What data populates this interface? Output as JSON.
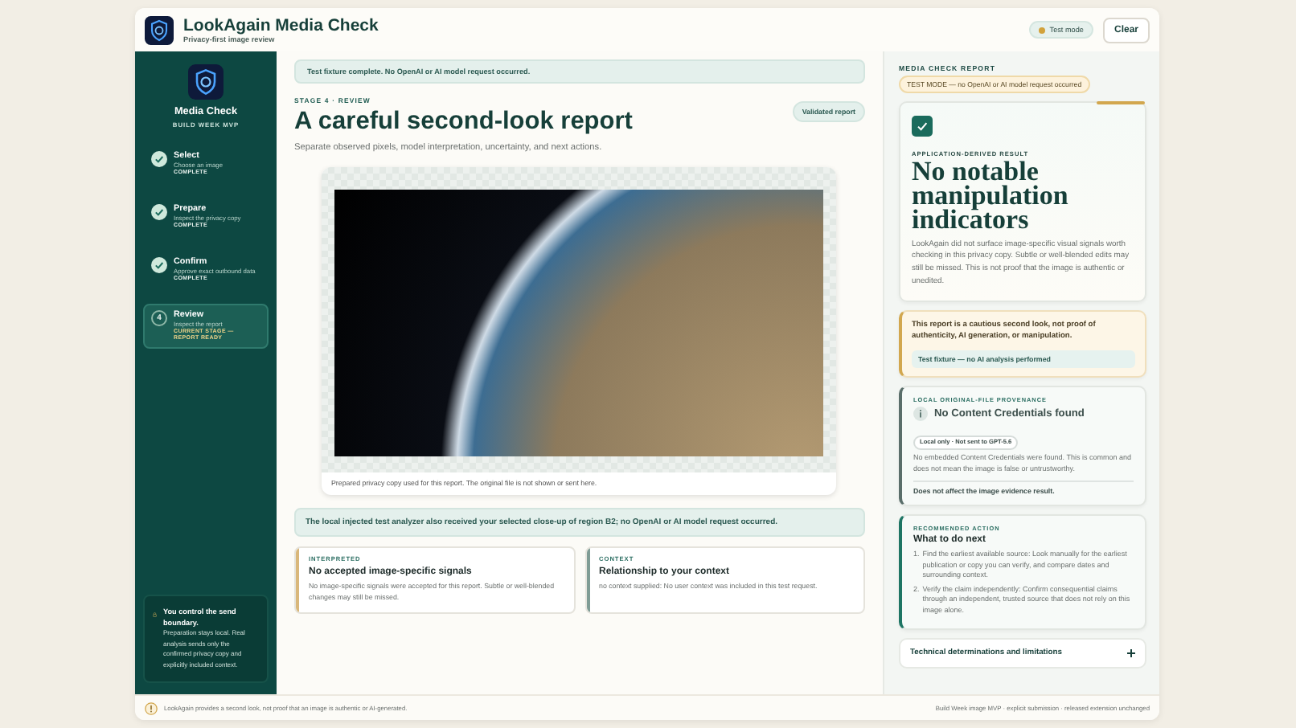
{
  "header": {
    "title": "LookAgain Media Check",
    "subtitle": "Privacy-first image review",
    "mode_badge": "Test mode",
    "clear_button": "Clear"
  },
  "sidebar": {
    "brand_title": "Media Check",
    "brand_subtitle": "BUILD WEEK MVP",
    "steps": [
      {
        "kind": "complete",
        "title": "Select",
        "description": "Choose an image",
        "status": "COMPLETE"
      },
      {
        "kind": "complete",
        "title": "Prepare",
        "description": "Inspect the privacy copy",
        "status": "COMPLETE"
      },
      {
        "kind": "complete",
        "title": "Confirm",
        "description": "Approve exact outbound data",
        "status": "COMPLETE"
      },
      {
        "kind": "current",
        "number": "4",
        "title": "Review",
        "description": "Inspect the report",
        "status": "CURRENT STAGE — REPORT READY"
      }
    ],
    "notice": {
      "title": "You control the send boundary.",
      "text": "Preparation stays local. Real analysis sends only the confirmed privacy copy and explicitly included context."
    }
  },
  "main": {
    "banner": "Test fixture complete. No OpenAI or AI model request occurred.",
    "eyebrow": "STAGE 4 · REVIEW",
    "heading": "A careful second-look report",
    "validated_badge": "Validated report",
    "subtitle": "Separate observed pixels, model interpretation, uncertainty, and next actions.",
    "image_caption": "Prepared privacy copy used for this report. The original file is not shown or sent here.",
    "analyzer_note": "The local injected test analyzer also received your selected close-up of region B2; no OpenAI or AI model request occurred.",
    "cards": [
      {
        "label": "INTERPRETED",
        "title": "No accepted image-specific signals",
        "text": "No image-specific signals were accepted for this report. Subtle or well-blended changes may still be missed.",
        "color": "#d9b77a"
      },
      {
        "label": "CONTEXT",
        "title": "Relationship to your context",
        "text": "no context supplied: No user context was included in this test request.",
        "color": "#7f9c95"
      }
    ]
  },
  "report": {
    "label": "MEDIA CHECK REPORT",
    "test_mode_badge": "TEST MODE — no OpenAI or AI model request occurred",
    "result": {
      "eyebrow": "APPLICATION-DERIVED RESULT",
      "title": "No notable manipulation indicators",
      "text": "LookAgain did not surface image-specific visual signals worth checking in this privacy copy. Subtle or well-blended edits may still be missed. This is not proof that the image is authentic or unedited."
    },
    "caution": {
      "text": "This report is a cautious second look, not proof of authenticity, AI generation, or manipulation.",
      "fixture": "Test fixture — no AI analysis performed"
    },
    "provenance": {
      "eyebrow": "LOCAL ORIGINAL-FILE PROVENANCE",
      "title": "No Content Credentials found",
      "badge": "Local only · Not sent to GPT-5.6",
      "text": "No embedded Content Credentials were found. This is common and does not mean the image is false or untrustworthy.",
      "note": "Does not affect the image evidence result."
    },
    "action": {
      "eyebrow": "RECOMMENDED ACTION",
      "title": "What to do next",
      "steps": [
        {
          "number": "1.",
          "text": "Find the earliest available source: Look manually for the earliest publication or copy you can verify, and compare dates and surrounding context."
        },
        {
          "number": "2.",
          "text": "Verify the claim independently: Confirm consequential claims through an independent, trusted source that does not rely on this image alone."
        }
      ]
    },
    "technical": {
      "title": "Technical determinations and limitations",
      "expanded": false
    }
  },
  "footer": {
    "left": "LookAgain provides a second look, not proof that an image is authentic or AI-generated.",
    "right": "Build Week image MVP · explicit submission · released extension unchanged"
  }
}
